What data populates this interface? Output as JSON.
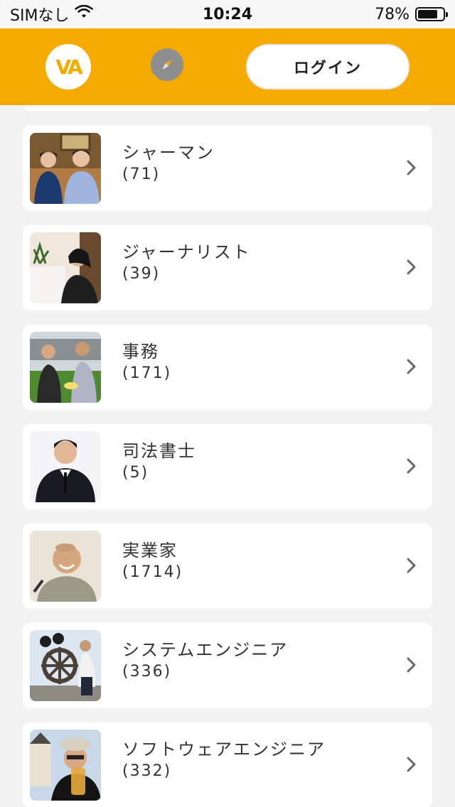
{
  "status_bar": {
    "carrier": "SIMなし",
    "time": "10:24",
    "battery": "78%",
    "battery_level": 0.78
  },
  "header": {
    "logo_text": "VA",
    "login_label": "ログイン",
    "brand_color": "#f5aa00"
  },
  "categories": [
    {
      "name": "シャーマン",
      "count": "(71)"
    },
    {
      "name": "ジャーナリスト",
      "count": "(39)"
    },
    {
      "name": "事務",
      "count": "(171)"
    },
    {
      "name": "司法書士",
      "count": "(5)"
    },
    {
      "name": "実業家",
      "count": "(1714)"
    },
    {
      "name": "システムエンジニア",
      "count": "(336)"
    },
    {
      "name": "ソフトウェアエンジニア",
      "count": "(332)"
    }
  ]
}
